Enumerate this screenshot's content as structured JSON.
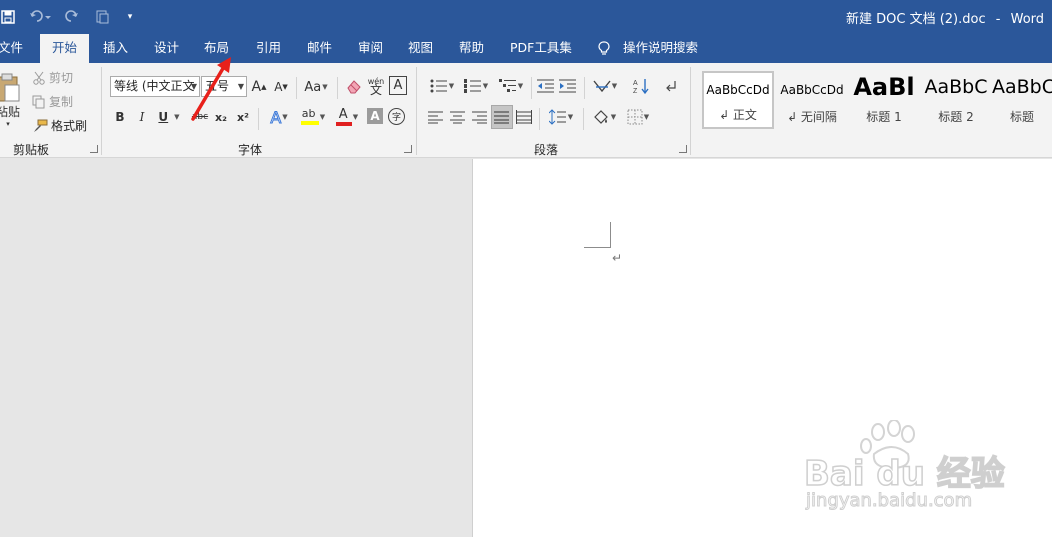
{
  "titlebar": {
    "doc_title": "新建 DOC 文档 (2).doc",
    "separator": "-",
    "app_name": "Word"
  },
  "tabs": [
    {
      "label": "文件"
    },
    {
      "label": "开始",
      "active": true
    },
    {
      "label": "插入"
    },
    {
      "label": "设计"
    },
    {
      "label": "布局"
    },
    {
      "label": "引用"
    },
    {
      "label": "邮件"
    },
    {
      "label": "审阅"
    },
    {
      "label": "视图"
    },
    {
      "label": "帮助"
    },
    {
      "label": "PDF工具集"
    }
  ],
  "tell_me": {
    "label": "操作说明搜索",
    "icon": "lightbulb-icon"
  },
  "clipboard": {
    "paste": "粘贴",
    "cut": "剪切",
    "copy": "复制",
    "format_painter": "格式刷",
    "group_label": "剪贴板"
  },
  "font": {
    "font_name": "等线 (中文正文",
    "font_size": "五号",
    "grow": "A",
    "shrink": "A",
    "change_case": "Aa",
    "phonetic_top": "wén",
    "phonetic_bottom": "文",
    "char_border": "A",
    "bold": "B",
    "italic": "I",
    "underline": "U",
    "strikethrough": "abc",
    "subscript": "x₂",
    "superscript": "x²",
    "text_effects": "A",
    "highlight": "ab",
    "font_color": "A",
    "char_shading": "A",
    "enclose": "字",
    "group_label": "字体"
  },
  "paragraph": {
    "group_label": "段落"
  },
  "styles": [
    {
      "sample": "AaBbCcDd",
      "name": "↲ 正文",
      "selected": true
    },
    {
      "sample": "AaBbCcDd",
      "name": "↲ 无间隔"
    },
    {
      "sample": "AaBl",
      "name": "标题 1"
    },
    {
      "sample": "AaBbC",
      "name": "标题 2"
    },
    {
      "sample": "AaBbC",
      "name": "标题"
    }
  ],
  "document": {
    "paragraph_mark": "↵"
  },
  "watermark": {
    "logo": "Bai du 经验",
    "url": "jingyan.baidu.com"
  },
  "colors": {
    "accent": "#2b579a",
    "ribbon_bg": "#f3f3f3",
    "canvas_bg": "#e6e6e6",
    "annotation_arrow": "#e8201a",
    "highlight_yellow": "#ffff00",
    "font_red": "#e02020"
  }
}
